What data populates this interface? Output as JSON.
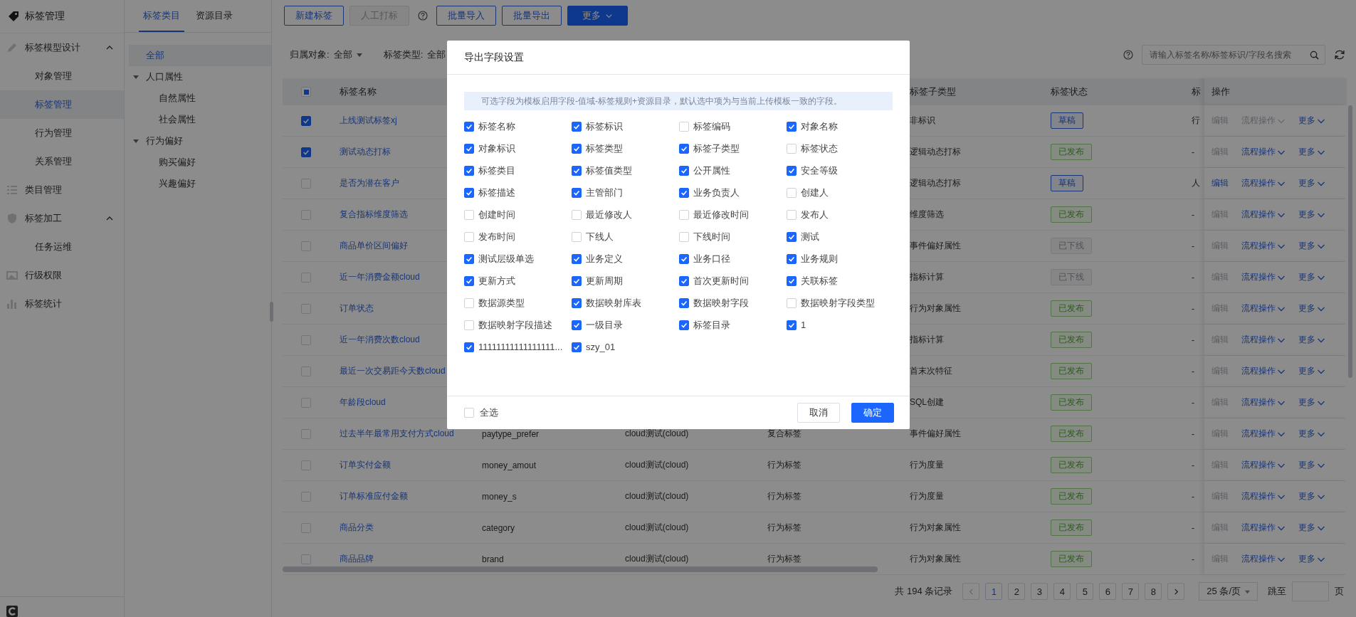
{
  "sidebar": {
    "title": "标签管理",
    "items": [
      {
        "label": "标签模型设计",
        "selected": false,
        "expanded": true,
        "children": [
          {
            "label": "对象管理",
            "selected": false
          },
          {
            "label": "标签管理",
            "selected": true
          },
          {
            "label": "行为管理",
            "selected": false
          },
          {
            "label": "关系管理",
            "selected": false
          }
        ]
      },
      {
        "label": "类目管理",
        "selected": false
      },
      {
        "label": "标签加工",
        "selected": false,
        "expanded": true,
        "children": [
          {
            "label": "任务运维",
            "selected": false
          }
        ]
      },
      {
        "label": "行级权限",
        "selected": false
      },
      {
        "label": "标签统计",
        "selected": false
      }
    ]
  },
  "tree": {
    "tabs": [
      {
        "label": "标签类目",
        "selected": true
      },
      {
        "label": "资源目录",
        "selected": false
      }
    ],
    "nodes": [
      {
        "label": "全部",
        "selected": true
      },
      {
        "label": "人口属性",
        "selected": false,
        "expanded": true,
        "children": [
          {
            "label": "自然属性",
            "selected": false
          },
          {
            "label": "社会属性",
            "selected": false
          }
        ]
      },
      {
        "label": "行为偏好",
        "selected": false,
        "expanded": true,
        "children": [
          {
            "label": "购买偏好",
            "selected": false
          },
          {
            "label": "兴趣偏好",
            "selected": false
          }
        ]
      }
    ]
  },
  "toolbar": [
    {
      "kind": "button",
      "label": "新建标签",
      "disabled": false
    },
    {
      "kind": "button",
      "label": "人工打标",
      "disabled": true
    },
    {
      "kind": "help"
    },
    {
      "kind": "button",
      "label": "批量导入",
      "disabled": false
    },
    {
      "kind": "button",
      "label": "批量导出",
      "disabled": false
    },
    {
      "kind": "primary",
      "label": "更多"
    }
  ],
  "filters": [
    {
      "label": "归属对象:",
      "value": "全部",
      "dropdown": true
    },
    {
      "label": "标签类型:",
      "value": "全部",
      "dropdown": false
    }
  ],
  "search": {
    "placeholder": "请输入标签名称/标签标识/字段名搜索"
  },
  "table": {
    "select_all": {
      "indeterminate": true
    },
    "columns": {
      "name": "标签名称",
      "subtype": "标签子类型",
      "status": "标签状态",
      "column_8": "标",
      "actions": "操作"
    },
    "rows": [
      {
        "checked": true,
        "name": "上线测试标签xj",
        "subtype": "非标识",
        "status": {
          "label": "草稿",
          "kind": "draft"
        },
        "column_8": "行",
        "actions": [
          {
            "label": "编辑",
            "kind": "link",
            "disabled": true
          },
          {
            "label": "流程操作",
            "kind": "menu",
            "disabled": true
          },
          {
            "label": "更多",
            "kind": "menu",
            "disabled": false
          }
        ]
      },
      {
        "checked": true,
        "name": "测试动态打标",
        "subtype": "逻辑动态打标",
        "status": {
          "label": "已发布",
          "kind": "published"
        },
        "column_8": "-",
        "actions": [
          {
            "label": "编辑",
            "kind": "link",
            "disabled": true
          },
          {
            "label": "流程操作",
            "kind": "menu",
            "disabled": false
          },
          {
            "label": "更多",
            "kind": "menu",
            "disabled": false
          }
        ]
      },
      {
        "checked": false,
        "name": "是否为潜在客户",
        "subtype": "逻辑动态打标",
        "status": {
          "label": "草稿",
          "kind": "draft"
        },
        "column_8": "人",
        "actions": [
          {
            "label": "编辑",
            "kind": "link",
            "disabled": false
          },
          {
            "label": "流程操作",
            "kind": "menu",
            "disabled": false
          },
          {
            "label": "更多",
            "kind": "menu",
            "disabled": false
          }
        ]
      },
      {
        "checked": false,
        "name": "复合指标维度筛选",
        "subtype": "维度筛选",
        "status": {
          "label": "已发布",
          "kind": "published"
        },
        "column_8": "-",
        "actions": [
          {
            "label": "编辑",
            "kind": "link",
            "disabled": true
          },
          {
            "label": "流程操作",
            "kind": "menu",
            "disabled": false
          },
          {
            "label": "更多",
            "kind": "menu",
            "disabled": false
          }
        ]
      },
      {
        "checked": false,
        "name": "商品单价区间偏好",
        "subtype": "事件偏好属性",
        "status": {
          "label": "已下线",
          "kind": "offline"
        },
        "column_8": "-",
        "actions": [
          {
            "label": "编辑",
            "kind": "link",
            "disabled": true
          },
          {
            "label": "流程操作",
            "kind": "menu",
            "disabled": false
          },
          {
            "label": "更多",
            "kind": "menu",
            "disabled": false
          }
        ]
      },
      {
        "checked": false,
        "name": "近一年消费金额cloud",
        "subtype": "指标计算",
        "status": {
          "label": "已下线",
          "kind": "offline"
        },
        "column_8": "-",
        "actions": [
          {
            "label": "编辑",
            "kind": "link",
            "disabled": true
          },
          {
            "label": "流程操作",
            "kind": "menu",
            "disabled": false
          },
          {
            "label": "更多",
            "kind": "menu",
            "disabled": false
          }
        ]
      },
      {
        "checked": false,
        "name": "订单状态",
        "subtype": "行为对象属性",
        "status": {
          "label": "已发布",
          "kind": "published"
        },
        "column_8": "-",
        "actions": [
          {
            "label": "编辑",
            "kind": "link",
            "disabled": true
          },
          {
            "label": "流程操作",
            "kind": "menu",
            "disabled": false
          },
          {
            "label": "更多",
            "kind": "menu",
            "disabled": false
          }
        ]
      },
      {
        "checked": false,
        "name": "近一年消费次数cloud",
        "subtype": "指标计算",
        "status": {
          "label": "已发布",
          "kind": "published"
        },
        "column_8": "-",
        "actions": [
          {
            "label": "编辑",
            "kind": "link",
            "disabled": true
          },
          {
            "label": "流程操作",
            "kind": "menu",
            "disabled": false
          },
          {
            "label": "更多",
            "kind": "menu",
            "disabled": false
          }
        ]
      },
      {
        "checked": false,
        "name": "最近一次交易距今天数cloud",
        "subtype": "首末次特征",
        "status": {
          "label": "已发布",
          "kind": "published"
        },
        "column_8": "-",
        "actions": [
          {
            "label": "编辑",
            "kind": "link",
            "disabled": true
          },
          {
            "label": "流程操作",
            "kind": "menu",
            "disabled": false
          },
          {
            "label": "更多",
            "kind": "menu",
            "disabled": false
          }
        ]
      },
      {
        "checked": false,
        "name": "年龄段cloud",
        "subtype": "SQL创建",
        "status": {
          "label": "已发布",
          "kind": "published"
        },
        "column_8": "-",
        "actions": [
          {
            "label": "编辑",
            "kind": "link",
            "disabled": true
          },
          {
            "label": "流程操作",
            "kind": "menu",
            "disabled": false
          },
          {
            "label": "更多",
            "kind": "menu",
            "disabled": false
          }
        ]
      },
      {
        "checked": false,
        "name": "过去半年最常用支付方式cloud",
        "column_3": "paytype_prefer",
        "column_4": "cloud测试(cloud)",
        "column_5": "复合标签",
        "subtype": "事件偏好属性",
        "status": {
          "label": "已发布",
          "kind": "published"
        },
        "column_8": "-",
        "actions": [
          {
            "label": "编辑",
            "kind": "link",
            "disabled": true
          },
          {
            "label": "流程操作",
            "kind": "menu",
            "disabled": false
          },
          {
            "label": "更多",
            "kind": "menu",
            "disabled": false
          }
        ]
      },
      {
        "checked": false,
        "name": "订单实付金额",
        "column_3": "money_amout",
        "column_4": "cloud测试(cloud)",
        "column_5": "行为标签",
        "subtype": "行为度量",
        "status": {
          "label": "已发布",
          "kind": "published"
        },
        "column_8": "-",
        "actions": [
          {
            "label": "编辑",
            "kind": "link",
            "disabled": true
          },
          {
            "label": "流程操作",
            "kind": "menu",
            "disabled": false
          },
          {
            "label": "更多",
            "kind": "menu",
            "disabled": false
          }
        ]
      },
      {
        "checked": false,
        "name": "订单标准应付金额",
        "column_3": "money_s",
        "column_4": "cloud测试(cloud)",
        "column_5": "行为标签",
        "subtype": "行为度量",
        "status": {
          "label": "已发布",
          "kind": "published"
        },
        "column_8": "-",
        "actions": [
          {
            "label": "编辑",
            "kind": "link",
            "disabled": true
          },
          {
            "label": "流程操作",
            "kind": "menu",
            "disabled": false
          },
          {
            "label": "更多",
            "kind": "menu",
            "disabled": false
          }
        ]
      },
      {
        "checked": false,
        "name": "商品分类",
        "column_3": "category",
        "column_4": "cloud测试(cloud)",
        "column_5": "行为标签",
        "subtype": "行为对象属性",
        "status": {
          "label": "已发布",
          "kind": "published"
        },
        "column_8": "-",
        "actions": [
          {
            "label": "编辑",
            "kind": "link",
            "disabled": true
          },
          {
            "label": "流程操作",
            "kind": "menu",
            "disabled": false
          },
          {
            "label": "更多",
            "kind": "menu",
            "disabled": false
          }
        ]
      },
      {
        "checked": false,
        "name": "商品品牌",
        "column_3": "brand",
        "column_4": "cloud测试(cloud)",
        "column_5": "行为标签",
        "subtype": "行为对象属性",
        "status": {
          "label": "已发布",
          "kind": "published"
        },
        "column_8": "-",
        "actions": [
          {
            "label": "编辑",
            "kind": "link",
            "disabled": true
          },
          {
            "label": "流程操作",
            "kind": "menu",
            "disabled": false
          },
          {
            "label": "更多",
            "kind": "menu",
            "disabled": false
          }
        ]
      }
    ]
  },
  "pagination": {
    "total": "共 194 条记录",
    "pages": [
      {
        "label": "1",
        "selected": true
      },
      {
        "label": "2",
        "selected": false
      },
      {
        "label": "3",
        "selected": false
      },
      {
        "label": "4",
        "selected": false
      },
      {
        "label": "5",
        "selected": false
      },
      {
        "label": "6",
        "selected": false
      },
      {
        "label": "7",
        "selected": false
      },
      {
        "label": "8",
        "selected": false
      }
    ],
    "page_size": "25 条/页",
    "jump_label": "跳至",
    "page_unit": "页"
  },
  "modal": {
    "title": "导出字段设置",
    "notice": "可选字段为模板启用字段-值域-标签规则+资源目录，默认选中项为与当前上传模板一致的字段。",
    "fields": [
      {
        "label": "标签名称",
        "checked": true
      },
      {
        "label": "标签标识",
        "checked": true
      },
      {
        "label": "标签编码",
        "checked": false
      },
      {
        "label": "对象名称",
        "checked": true
      },
      {
        "label": "对象标识",
        "checked": true
      },
      {
        "label": "标签类型",
        "checked": true
      },
      {
        "label": "标签子类型",
        "checked": true
      },
      {
        "label": "标签状态",
        "checked": false
      },
      {
        "label": "标签类目",
        "checked": true
      },
      {
        "label": "标签值类型",
        "checked": true
      },
      {
        "label": "公开属性",
        "checked": true
      },
      {
        "label": "安全等级",
        "checked": true
      },
      {
        "label": "标签描述",
        "checked": true
      },
      {
        "label": "主管部门",
        "checked": true
      },
      {
        "label": "业务负责人",
        "checked": true
      },
      {
        "label": "创建人",
        "checked": false
      },
      {
        "label": "创建时间",
        "checked": false
      },
      {
        "label": "最近修改人",
        "checked": false
      },
      {
        "label": "最近修改时间",
        "checked": false
      },
      {
        "label": "发布人",
        "checked": false
      },
      {
        "label": "发布时间",
        "checked": false
      },
      {
        "label": "下线人",
        "checked": false
      },
      {
        "label": "下线时间",
        "checked": false
      },
      {
        "label": "测试",
        "checked": true
      },
      {
        "label": "测试层级单选",
        "checked": true
      },
      {
        "label": "业务定义",
        "checked": true
      },
      {
        "label": "业务口径",
        "checked": true
      },
      {
        "label": "业务规则",
        "checked": true
      },
      {
        "label": "更新方式",
        "checked": true
      },
      {
        "label": "更新周期",
        "checked": true
      },
      {
        "label": "首次更新时间",
        "checked": true
      },
      {
        "label": "关联标签",
        "checked": true
      },
      {
        "label": "数据源类型",
        "checked": false
      },
      {
        "label": "数据映射库表",
        "checked": true
      },
      {
        "label": "数据映射字段",
        "checked": true
      },
      {
        "label": "数据映射字段类型",
        "checked": false
      },
      {
        "label": "数据映射字段描述",
        "checked": false
      },
      {
        "label": "一级目录",
        "checked": true
      },
      {
        "label": "标签目录",
        "checked": true
      },
      {
        "label": "1",
        "checked": true
      },
      {
        "label": "11111111111111111...",
        "checked": true
      },
      {
        "label": "szy_01",
        "checked": true
      }
    ],
    "select_all": {
      "label": "全选",
      "checked": false
    },
    "buttons": [
      {
        "label": "取消",
        "kind": "default"
      },
      {
        "label": "确定",
        "kind": "primary"
      }
    ]
  }
}
